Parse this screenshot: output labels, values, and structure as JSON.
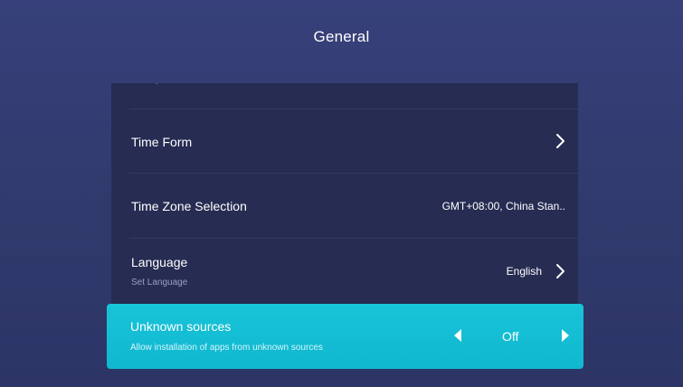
{
  "header": {
    "title": "General"
  },
  "settings": {
    "partial_item_text": "˒",
    "items": [
      {
        "label": "Time Form",
        "sublabel": "",
        "value": "",
        "control": "chevron-right"
      },
      {
        "label": "Time Zone Selection",
        "sublabel": "",
        "value": "GMT+08:00, China Stan..",
        "control": "none"
      },
      {
        "label": "Language",
        "sublabel": "Set Language",
        "value": "English",
        "control": "chevron-right"
      }
    ],
    "focused_item": {
      "label": "Unknown sources",
      "sublabel": "Allow installation of apps from unknown sources",
      "value": "Off",
      "control": "left-right-selector"
    }
  },
  "colors": {
    "background": "#333c73",
    "row_background": "#262c52",
    "accent": "#14bfd6",
    "text_primary": "#ffffff",
    "text_secondary": "#9aa0c4"
  },
  "icons": [
    "chevron-right-icon",
    "arrow-left-icon",
    "arrow-right-icon"
  ]
}
